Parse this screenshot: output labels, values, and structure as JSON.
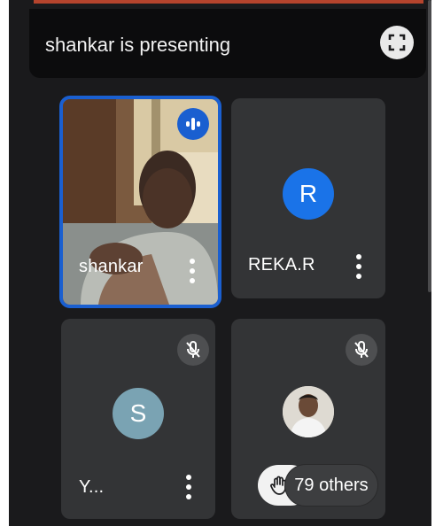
{
  "banner": {
    "text": "shankar is presenting",
    "button_icon": "fullscreen-icon"
  },
  "tiles": [
    {
      "name": "shankar",
      "speaking": true,
      "has_video": true,
      "active_border_color": "#1a5fd0",
      "indicator_icon": "speaking-indicator-icon"
    },
    {
      "name": "REKA.R",
      "avatar_letter": "R",
      "avatar_color": "#1a73e8"
    },
    {
      "name": "Y...",
      "avatar_letter": "S",
      "avatar_color": "#7aa3b3",
      "muted": true
    },
    {
      "avatar_photo": true,
      "muted": true,
      "hand_raised": true,
      "others_label": "79 others"
    }
  ]
}
